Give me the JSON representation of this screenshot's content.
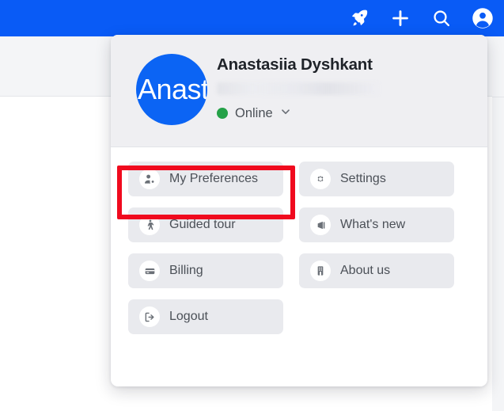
{
  "topbar": {
    "background_color": "#095BF6",
    "icons": [
      {
        "name": "rocket-icon",
        "label": "Rocket"
      },
      {
        "name": "plus-icon",
        "label": "Create new"
      },
      {
        "name": "search-icon",
        "label": "Search"
      },
      {
        "name": "account-avatar-icon",
        "label": "Account"
      }
    ]
  },
  "popup": {
    "user": {
      "name": "Anastasiia Dyshkant",
      "avatar_initials": "Anastasiia",
      "avatar_color": "#0B64F4",
      "email_redacted": true,
      "status_label": "Online",
      "status_color": "#24A148",
      "status_chevron": "chevron-down-icon"
    },
    "menu_items": [
      {
        "label": "My Preferences",
        "icon": "user-settings-icon",
        "highlighted": true
      },
      {
        "label": "Settings",
        "icon": "gear-icon",
        "highlighted": false
      },
      {
        "label": "Guided tour",
        "icon": "walking-person-icon",
        "highlighted": false
      },
      {
        "label": "What's new",
        "icon": "megaphone-icon",
        "highlighted": false
      },
      {
        "label": "Billing",
        "icon": "credit-card-icon",
        "highlighted": false
      },
      {
        "label": "About us",
        "icon": "building-icon",
        "highlighted": false
      },
      {
        "label": "Logout",
        "icon": "logout-arrow-icon",
        "highlighted": false
      }
    ]
  },
  "annotation": {
    "highlight_color": "#F00A1E",
    "target": "My Preferences"
  }
}
